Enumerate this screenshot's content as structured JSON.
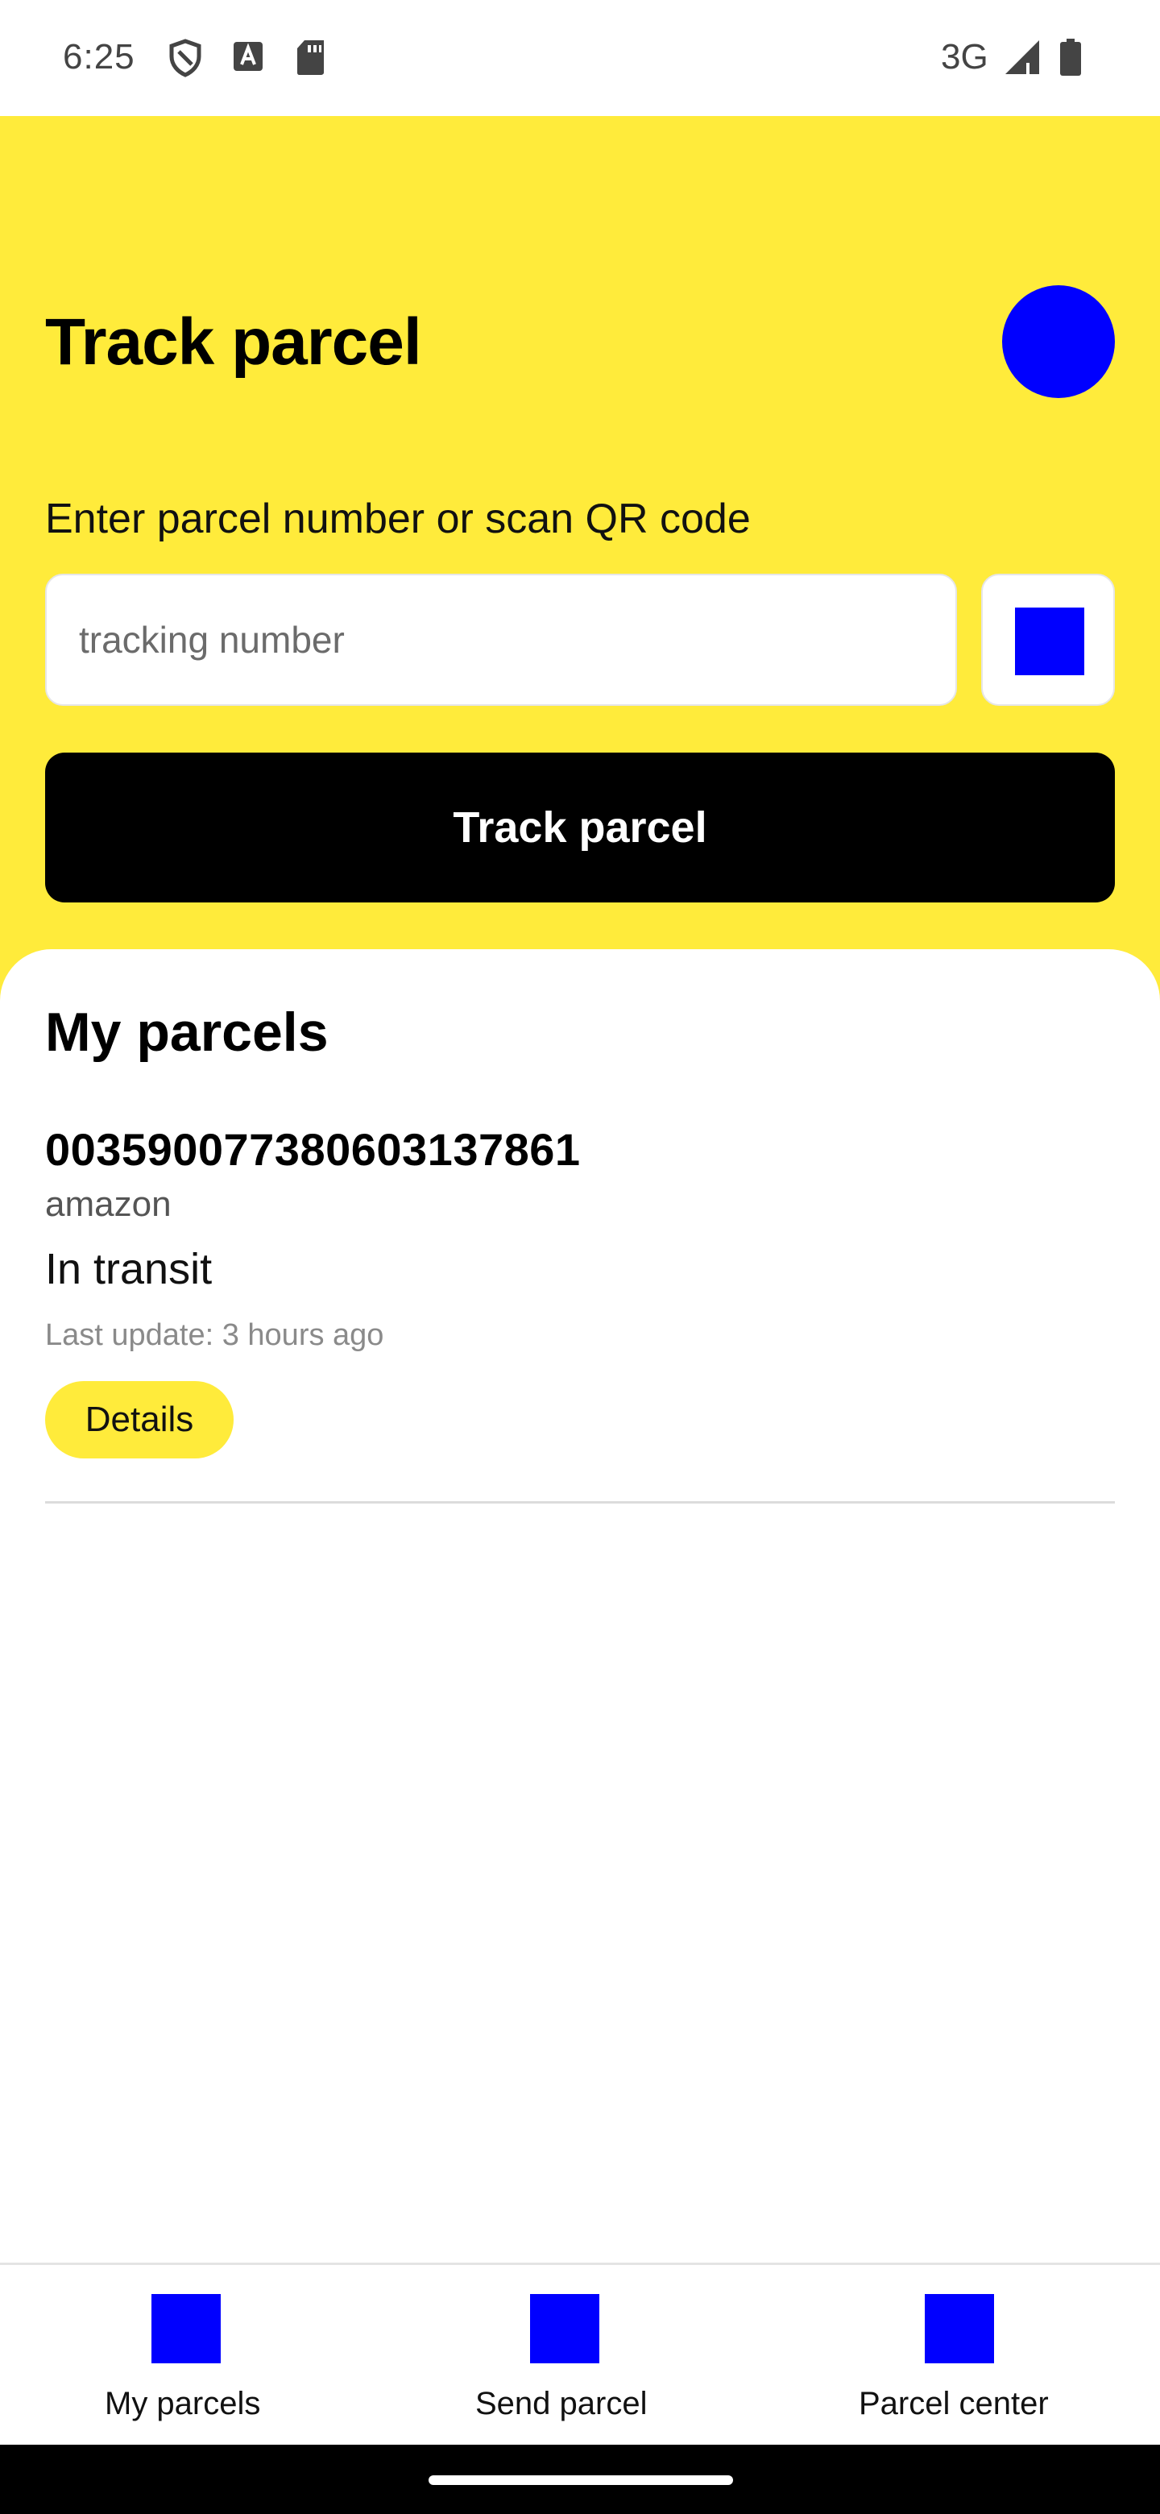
{
  "status_bar": {
    "time": "6:25",
    "icons": [
      "shield-icon",
      "font-a-icon",
      "sd-card-icon"
    ],
    "network": "3G",
    "right_icons": [
      "signal-icon",
      "battery-icon"
    ]
  },
  "header": {
    "title": "Track parcel",
    "avatar_color": "#0000ff",
    "prompt": "Enter parcel number or scan QR code",
    "input_placeholder": "tracking number",
    "input_value": "",
    "qr_button_icon": "qr-scan-icon",
    "track_button_label": "Track parcel",
    "background_color": "#ffeb3b"
  },
  "my_parcels": {
    "title": "My parcels",
    "items": [
      {
        "number": "00359007738060313786​1",
        "sender": "amazon",
        "status": "In transit",
        "last_update": "Last update: 3 hours ago",
        "details_label": "Details"
      }
    ]
  },
  "bottom_nav": {
    "items": [
      {
        "label": "My parcels",
        "icon": "parcels-icon"
      },
      {
        "label": "Send parcel",
        "icon": "send-parcel-icon"
      },
      {
        "label": "Parcel center",
        "icon": "parcel-center-icon"
      }
    ]
  },
  "colors": {
    "accent_yellow": "#ffeb3b",
    "placeholder_blue": "#0000ff",
    "primary_button": "#000000"
  }
}
